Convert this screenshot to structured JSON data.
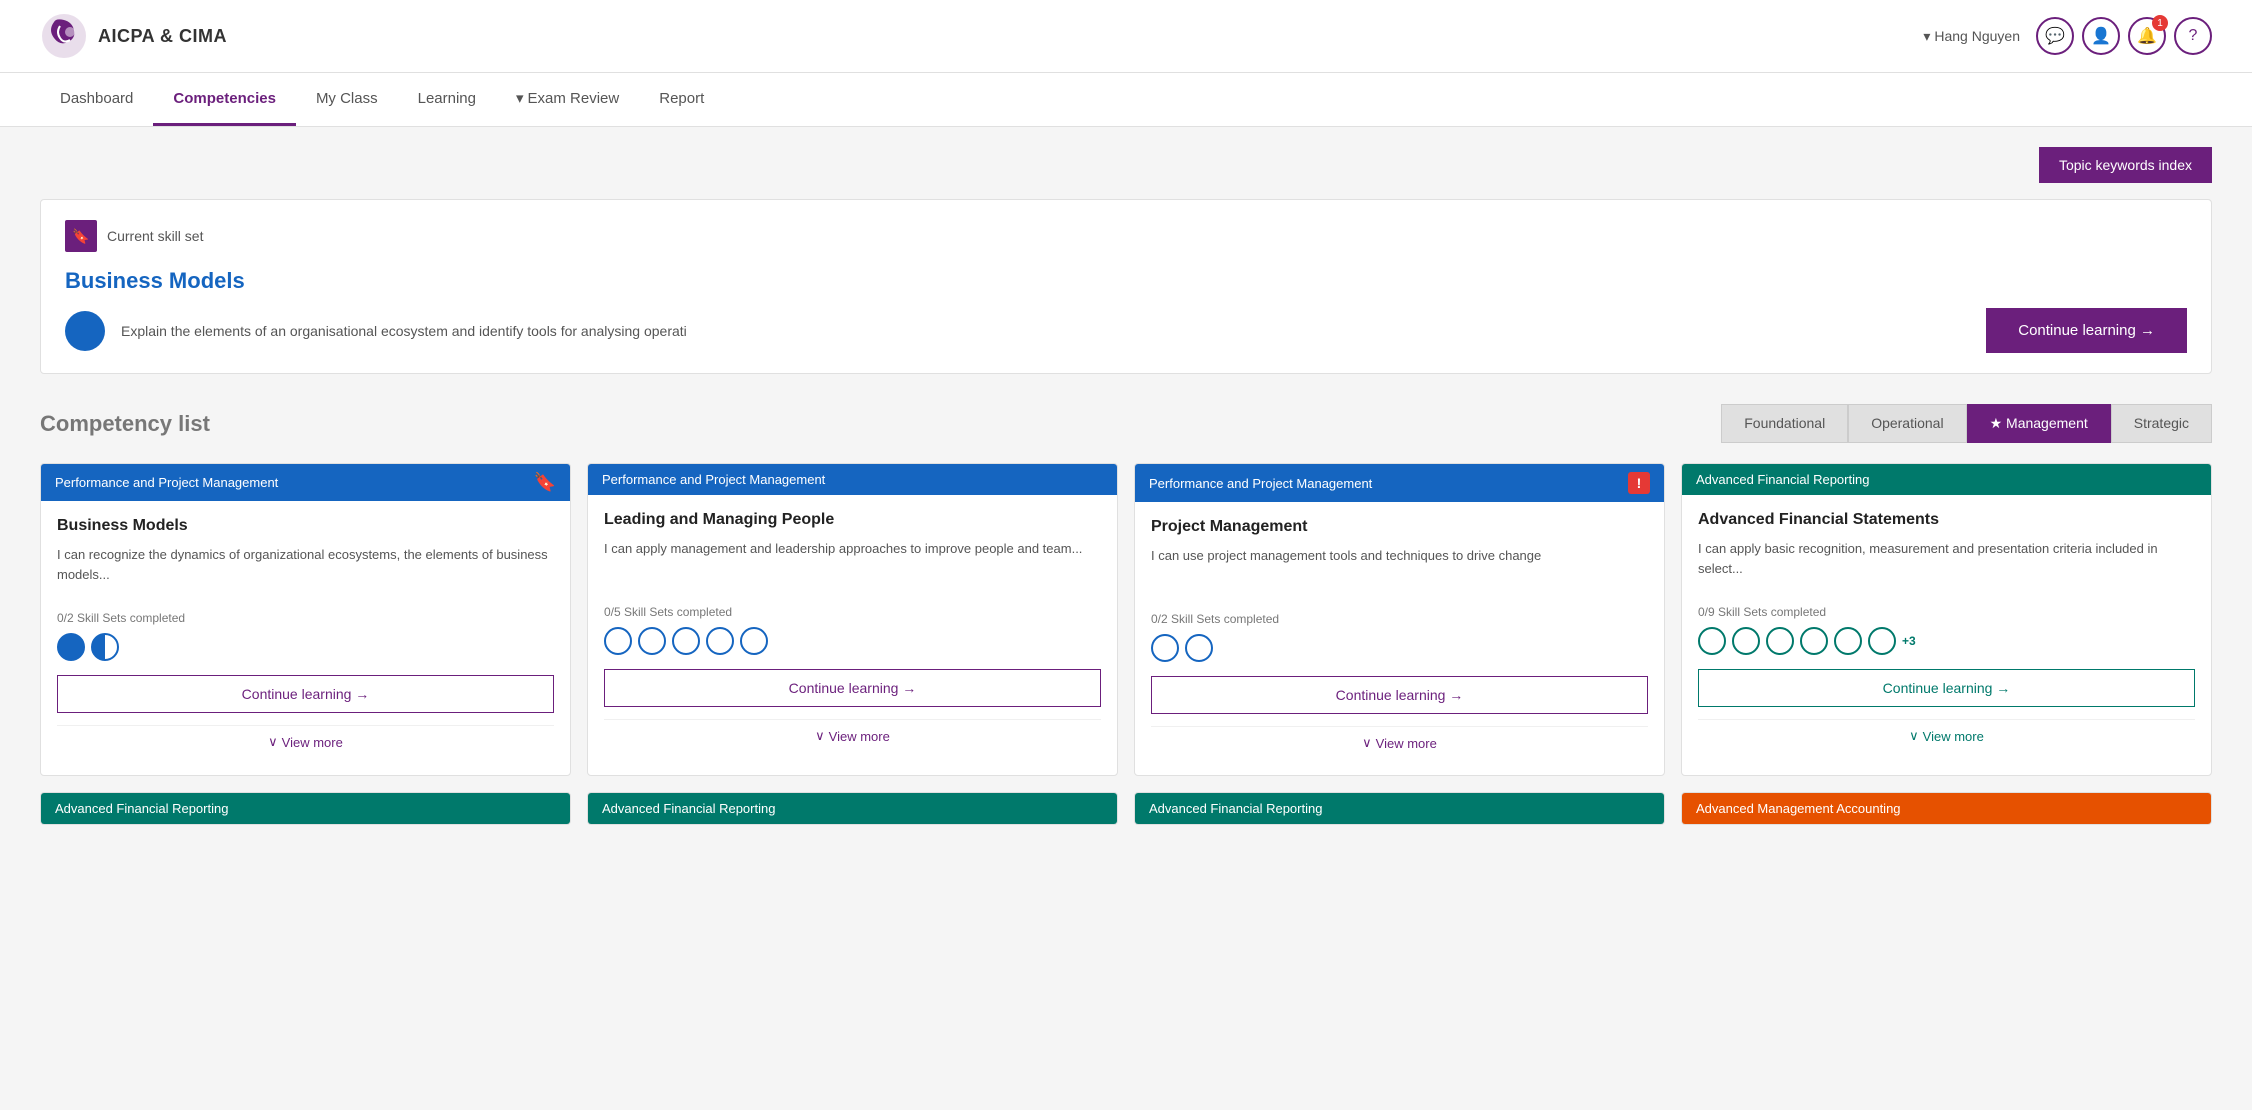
{
  "header": {
    "logo_text": "AICPA & CIMA",
    "user_name": "Hang Nguyen",
    "chevron": "▾"
  },
  "nav": {
    "items": [
      {
        "label": "Dashboard",
        "active": false
      },
      {
        "label": "Competencies",
        "active": true
      },
      {
        "label": "My Class",
        "active": false
      },
      {
        "label": "Learning",
        "active": false
      },
      {
        "label": "Exam Review",
        "active": false,
        "dropdown": true
      },
      {
        "label": "Report",
        "active": false
      }
    ]
  },
  "topic_keywords_btn": "Topic keywords index",
  "current_skill": {
    "header_label": "Current skill set",
    "title": "Business Models",
    "description": "Explain the elements of an organisational ecosystem and identify tools for analysing operati",
    "continue_btn": "Continue learning →"
  },
  "competency_list": {
    "title": "Competency list",
    "filters": [
      {
        "label": "Foundational",
        "active": false
      },
      {
        "label": "Operational",
        "active": false
      },
      {
        "label": "Management",
        "active": true,
        "star": true
      },
      {
        "label": "Strategic",
        "active": false
      }
    ],
    "cards": [
      {
        "category": "Performance and Project Management",
        "category_color": "blue",
        "title": "Business Models",
        "description": "I can recognize the dynamics of organizational ecosystems, the elements of business models...",
        "skill_sets": "0/2 Skill Sets completed",
        "dots": [
          "filled",
          "half"
        ],
        "extra_dots": 0,
        "continue_btn": "Continue learning →",
        "view_more": "View more",
        "has_bookmark": true,
        "has_exclamation": false
      },
      {
        "category": "Performance and Project Management",
        "category_color": "blue",
        "title": "Leading and Managing People",
        "description": "I can apply management and leadership approaches to improve people and team...",
        "skill_sets": "0/5 Skill Sets completed",
        "dots": [
          "empty",
          "empty",
          "empty",
          "empty",
          "empty"
        ],
        "extra_dots": 0,
        "continue_btn": "Continue learning →",
        "view_more": "View more",
        "has_bookmark": false,
        "has_exclamation": false
      },
      {
        "category": "Performance and Project Management",
        "category_color": "blue",
        "title": "Project Management",
        "description": "I can use project management tools and techniques to drive change",
        "skill_sets": "0/2 Skill Sets completed",
        "dots": [
          "empty",
          "empty"
        ],
        "extra_dots": 0,
        "continue_btn": "Continue learning →",
        "view_more": "View more",
        "has_bookmark": false,
        "has_exclamation": true
      },
      {
        "category": "Advanced Financial Reporting",
        "category_color": "teal",
        "title": "Advanced Financial Statements",
        "description": "I can apply basic recognition, measurement and presentation criteria included in select...",
        "skill_sets": "0/9 Skill Sets completed",
        "dots": [
          "empty",
          "empty",
          "empty",
          "empty",
          "empty",
          "empty"
        ],
        "extra_dots": 3,
        "continue_btn": "Continue learning →",
        "view_more": "View more",
        "has_bookmark": false,
        "has_exclamation": false
      }
    ],
    "bottom_cards": [
      {
        "label": "Advanced Financial Reporting",
        "color": "teal"
      },
      {
        "label": "Advanced Financial Reporting",
        "color": "teal"
      },
      {
        "label": "Advanced Financial Reporting",
        "color": "teal"
      },
      {
        "label": "Advanced Management Accounting",
        "color": "orange"
      }
    ]
  }
}
